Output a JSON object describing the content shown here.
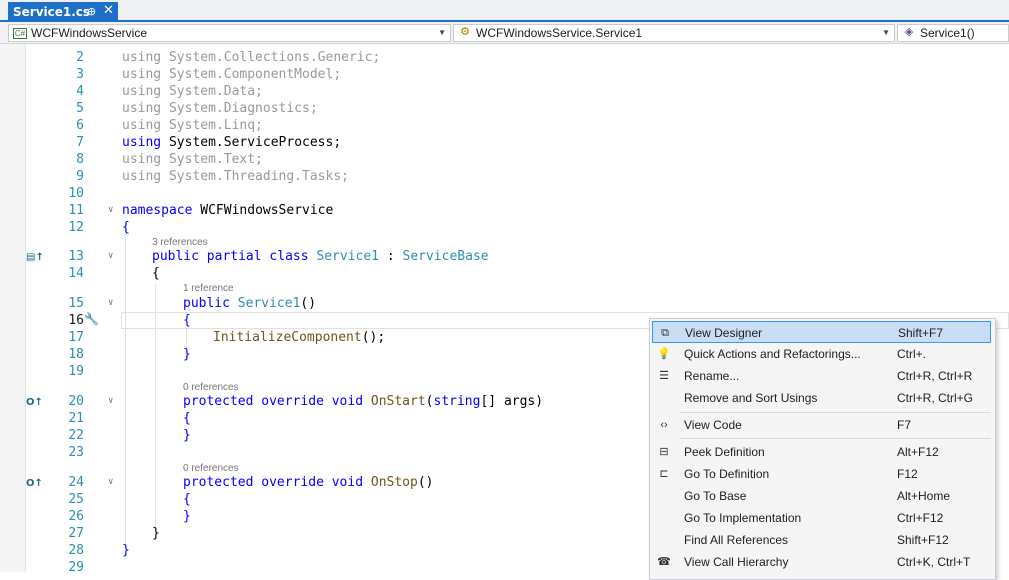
{
  "tab": {
    "title": "Service1.cs",
    "pin": "⊕",
    "close": "✕"
  },
  "nav": {
    "project": "WCFWindowsService",
    "class": "WCFWindowsService.Service1",
    "member": "Service1()"
  },
  "codelens": {
    "class_refs": "3 references",
    "ctor_refs": "1 reference",
    "onstart_refs": "0 references",
    "onstop_refs": "0 references"
  },
  "lines": [
    {
      "n": "2",
      "code": "using System.Collections.Generic;"
    },
    {
      "n": "3",
      "code": "using System.ComponentModel;"
    },
    {
      "n": "4",
      "code": "using System.Data;"
    },
    {
      "n": "5",
      "code": "using System.Diagnostics;"
    },
    {
      "n": "6",
      "code": "using System.Linq;"
    },
    {
      "n": "7",
      "code": "using System.ServiceProcess;"
    },
    {
      "n": "8",
      "code": "using System.Text;"
    },
    {
      "n": "9",
      "code": "using System.Threading.Tasks;"
    },
    {
      "n": "10",
      "code": ""
    },
    {
      "n": "11",
      "code": "namespace WCFWindowsService"
    },
    {
      "n": "12",
      "code": "{"
    },
    {
      "n": "13",
      "code": "public partial class Service1 : ServiceBase"
    },
    {
      "n": "14",
      "code": "{"
    },
    {
      "n": "15",
      "code": "public Service1()"
    },
    {
      "n": "16",
      "code": "{"
    },
    {
      "n": "17",
      "code": "InitializeComponent();"
    },
    {
      "n": "18",
      "code": "}"
    },
    {
      "n": "19",
      "code": ""
    },
    {
      "n": "20",
      "code": "protected override void OnStart(string[] args)"
    },
    {
      "n": "21",
      "code": "{"
    },
    {
      "n": "22",
      "code": "}"
    },
    {
      "n": "23",
      "code": ""
    },
    {
      "n": "24",
      "code": "protected override void OnStop()"
    },
    {
      "n": "25",
      "code": "{"
    },
    {
      "n": "26",
      "code": "}"
    },
    {
      "n": "27",
      "code": "}"
    },
    {
      "n": "28",
      "code": "}"
    },
    {
      "n": "29",
      "code": ""
    }
  ],
  "menu": [
    {
      "label": "View Designer",
      "shortcut": "Shift+F7",
      "icon": "view-designer-icon"
    },
    {
      "label": "Quick Actions and Refactorings...",
      "shortcut": "Ctrl+.",
      "icon": "lightbulb-icon"
    },
    {
      "label": "Rename...",
      "shortcut": "Ctrl+R, Ctrl+R",
      "icon": "rename-icon"
    },
    {
      "label": "Remove and Sort Usings",
      "shortcut": "Ctrl+R, Ctrl+G",
      "icon": ""
    },
    {
      "label": "View Code",
      "shortcut": "F7",
      "icon": "code-icon"
    },
    {
      "label": "Peek Definition",
      "shortcut": "Alt+F12",
      "icon": "peek-definition-icon"
    },
    {
      "label": "Go To Definition",
      "shortcut": "F12",
      "icon": "go-to-definition-icon"
    },
    {
      "label": "Go To Base",
      "shortcut": "Alt+Home",
      "icon": ""
    },
    {
      "label": "Go To Implementation",
      "shortcut": "Ctrl+F12",
      "icon": ""
    },
    {
      "label": "Find All References",
      "shortcut": "Shift+F12",
      "icon": ""
    },
    {
      "label": "View Call Hierarchy",
      "shortcut": "Ctrl+K, Ctrl+T",
      "icon": "call-hierarchy-icon"
    }
  ]
}
